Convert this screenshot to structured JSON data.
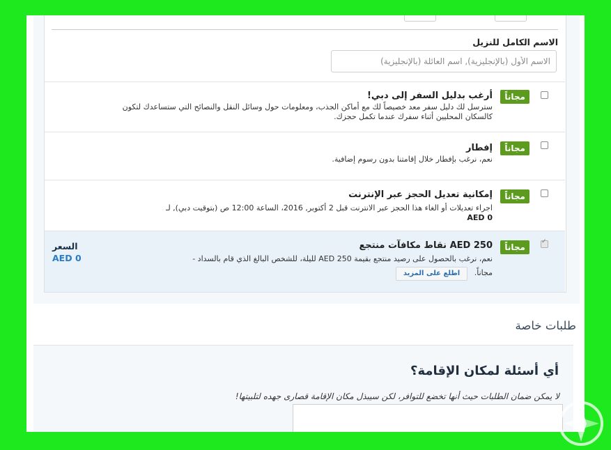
{
  "name_field": {
    "label": "الاسم الكامل للنزيل",
    "placeholder": "الاسم الأول (بالإنجليزية), اسم العائلة (بالإنجليزية)"
  },
  "options": [
    {
      "badge": "مجاناً",
      "title": "أرغب بدليل السفر إلى دبي!",
      "desc": "سترسل لك دليل سفر معد خصيصاً لك مع أماكن الجذب، ومعلومات حول وسائل النقل والنصائح التي ستساعدك لتكون كالسكان المحليين أثناء سفرك عندما تكمل حجزك.",
      "checked": false
    },
    {
      "badge": "مجاناً",
      "title": "إفطار",
      "desc": "نعم، نرغب بإفطار خلال إقامتنا بدون رسوم إضافية.",
      "checked": false
    },
    {
      "badge": "مجاناً",
      "title": "إمكانية تعديل الحجز عبر الإنترنت",
      "desc": "اجراء تعديلات أو الغاء هذا الحجز عبر الانترنت قبل 2 أكتوبر, 2016، الساعة 12:00 ص (بتوقيت دبي), لـ",
      "desc_bold": "AED 0",
      "checked": false
    },
    {
      "badge": "مجاناً",
      "title": "250 AED نقاط مكافآت منتجع",
      "desc": "نعم، نرغب بالحصول على رصيد منتجع بقيمة 250 AED لليلة، للشخص البالغ الذي قام بالسداد -",
      "desc_tail": "مجاناً.",
      "more": "اطلع على المزيد",
      "price_label": "السعر",
      "price_value": "AED 0",
      "checked": true
    }
  ],
  "special_requests": {
    "title": "طلبات خاصة",
    "question": "أي أسئلة لمكان الإقامة؟",
    "note": "لا يمكن ضمان الطلبات حيث أنها تخضع للتوافر، لكن سيبذل مكان الإقامة قصارى جهده لتلبيتها!"
  },
  "colors": {
    "badge": "#5d9b1e",
    "frame": "#1ee81e",
    "selected_row": "#e9f2f9",
    "price": "#2a7cc4"
  }
}
